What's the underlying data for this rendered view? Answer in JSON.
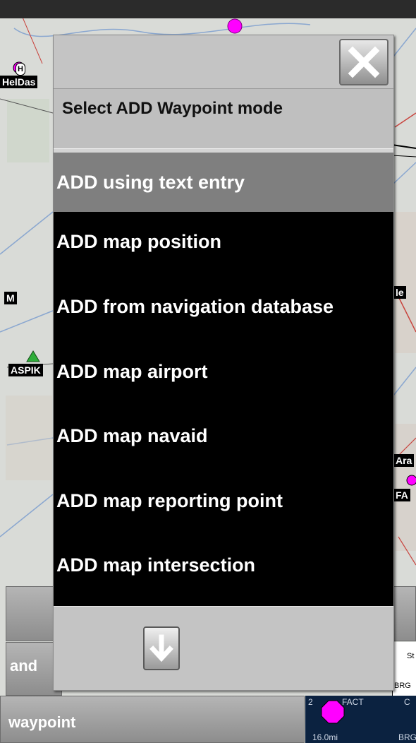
{
  "dialog": {
    "title": "Select ADD Waypoint mode",
    "close_icon": "close-x-icon",
    "scroll_icon": "arrow-down-icon",
    "selected_index": 0,
    "items": [
      {
        "label": "ADD using text entry"
      },
      {
        "label": "ADD map position"
      },
      {
        "label": "ADD from navigation database"
      },
      {
        "label": "ADD map airport"
      },
      {
        "label": "ADD map navaid"
      },
      {
        "label": "ADD map reporting point"
      },
      {
        "label": "ADD map intersection"
      }
    ]
  },
  "background": {
    "button_and": "and",
    "button_waypoint": "waypoint",
    "info_panel": {
      "label_st": "St",
      "label_brg": "BRG"
    },
    "waypoint_strip": {
      "index": "2",
      "name": "FACT",
      "code": "C",
      "distance": "16.0mi",
      "brg": "BRG"
    },
    "map_labels": {
      "heldas": "HelDas",
      "heli": "H",
      "aspik": "ASPIK",
      "m": "M",
      "le": "le",
      "ara": "Ara",
      "fa": "FA"
    },
    "colors": {
      "waypoint_magenta": "#ff00ff",
      "marker_green": "#2fae3a"
    }
  }
}
